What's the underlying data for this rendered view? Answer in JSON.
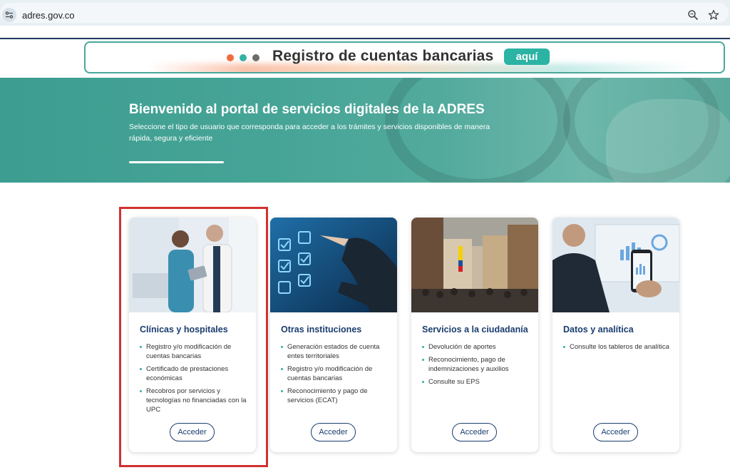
{
  "browser": {
    "url": "adres.gov.co"
  },
  "banner": {
    "title": "Registro de cuentas bancarias",
    "cta": "aquí"
  },
  "hero": {
    "title": "Bienvenido al portal de servicios digitales de la ADRES",
    "subtitle": "Seleccione el tipo de usuario que corresponda para acceder a los trámites y servicios disponibles de manera rápida, segura y eficiente"
  },
  "cards": [
    {
      "title": "Clínicas y hospitales",
      "items": [
        "Registro y/o modificación de cuentas bancarias",
        "Certificado de prestaciones económicas",
        "Recobros por servicios y tecnologías no financiadas con la UPC"
      ],
      "button": "Acceder"
    },
    {
      "title": "Otras instituciones",
      "items": [
        "Generación estados de cuenta entes territoriales",
        "Registro y/o modificación de cuentas bancarias",
        "Reconocimiento y pago de servicios (ECAT)"
      ],
      "button": "Acceder"
    },
    {
      "title": "Servicios a la ciudadanía",
      "items": [
        "Devolución de aportes",
        "Reconocimiento, pago de indemnizaciones y auxilios",
        "Consulte su EPS"
      ],
      "button": "Acceder"
    },
    {
      "title": "Datos y analítica",
      "items": [
        "Consulte los tableros de analítica"
      ],
      "button": "Acceder"
    }
  ],
  "colors": {
    "accent": "#2bb3a4",
    "primary": "#1a3d6e",
    "highlight": "#d23030"
  }
}
